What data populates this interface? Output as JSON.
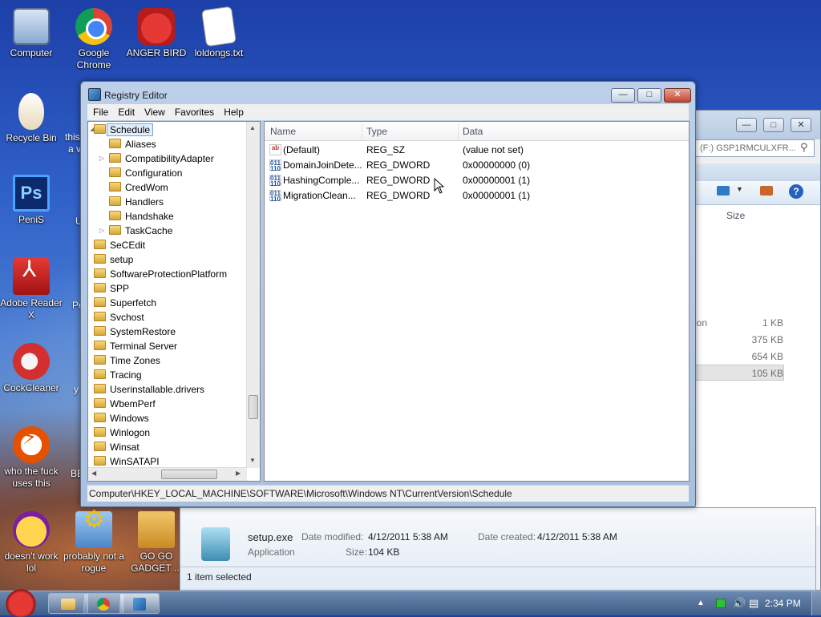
{
  "desktop": {
    "icons": [
      {
        "label": "Computer",
        "icon": "computer-icon"
      },
      {
        "label": "Google Chrome",
        "icon": "chrome-icon"
      },
      {
        "label": "ANGER BIRD",
        "icon": "angry-birds-icon"
      },
      {
        "label": "loldongs.txt",
        "icon": "text-file-icon"
      },
      {
        "label": "Recycle Bin",
        "icon": "recycle-bin-icon"
      },
      {
        "label": "PeniS",
        "icon": "photoshop-icon"
      },
      {
        "label": "Adobe Reader X",
        "icon": "adobe-reader-icon"
      },
      {
        "label": "CockCleaner",
        "icon": "ccleaner-icon"
      },
      {
        "label": "who the fuck uses this",
        "icon": "flash-icon"
      },
      {
        "label": "doesn't work lol",
        "icon": "yahoo-messenger-icon"
      },
      {
        "label": "probably not a rogue",
        "icon": "gears-icon"
      },
      {
        "label": "GO GO GADGET ...",
        "icon": "gadget-folder-icon"
      }
    ],
    "partial_labels": [
      "this",
      "a v",
      "U",
      "Pe",
      "y",
      "BE"
    ]
  },
  "registry_editor": {
    "title": "Registry Editor",
    "menu": [
      "File",
      "Edit",
      "View",
      "Favorites",
      "Help"
    ],
    "tree": {
      "selected": "Schedule",
      "children": [
        "Aliases",
        "CompatibilityAdapter",
        "Configuration",
        "CredWom",
        "Handlers",
        "Handshake",
        "TaskCache"
      ],
      "siblings": [
        "SeCEdit",
        "setup",
        "SoftwareProtectionPlatform",
        "SPP",
        "Superfetch",
        "Svchost",
        "SystemRestore",
        "Terminal Server",
        "Time Zones",
        "Tracing",
        "Userinstallable.drivers",
        "WbemPerf",
        "Windows",
        "Winlogon",
        "Winsat",
        "WinSATAPI"
      ]
    },
    "columns": [
      "Name",
      "Type",
      "Data"
    ],
    "values": [
      {
        "name": "(Default)",
        "type": "REG_SZ",
        "data": "(value not set)",
        "icon": "string-value-icon"
      },
      {
        "name": "DomainJoinDete...",
        "type": "REG_DWORD",
        "data": "0x00000000 (0)",
        "icon": "binary-value-icon"
      },
      {
        "name": "HashingComple...",
        "type": "REG_DWORD",
        "data": "0x00000001 (1)",
        "icon": "binary-value-icon"
      },
      {
        "name": "MigrationClean...",
        "type": "REG_DWORD",
        "data": "0x00000001 (1)",
        "icon": "binary-value-icon"
      }
    ],
    "status_path": "Computer\\HKEY_LOCAL_MACHINE\\SOFTWARE\\Microsoft\\Windows NT\\CurrentVersion\\Schedule"
  },
  "explorer": {
    "address": "(F:) GSP1RMCULXFR...",
    "size_header": "Size",
    "partial_type": "ion",
    "sizes": [
      "1 KB",
      "375 KB",
      "654 KB",
      "105 KB"
    ],
    "details": {
      "filename": "setup.exe",
      "filetype": "Application",
      "modified_label": "Date modified:",
      "modified_value": "4/12/2011 5:38 AM",
      "created_label": "Date created:",
      "created_value": "4/12/2011 5:38 AM",
      "size_label": "Size:",
      "size_value": "104 KB",
      "selection": "1 item selected"
    }
  },
  "taskbar": {
    "clock": "2:34 PM",
    "buttons": [
      "explorer-folder-icon",
      "chrome-icon",
      "registry-editor-icon"
    ]
  }
}
